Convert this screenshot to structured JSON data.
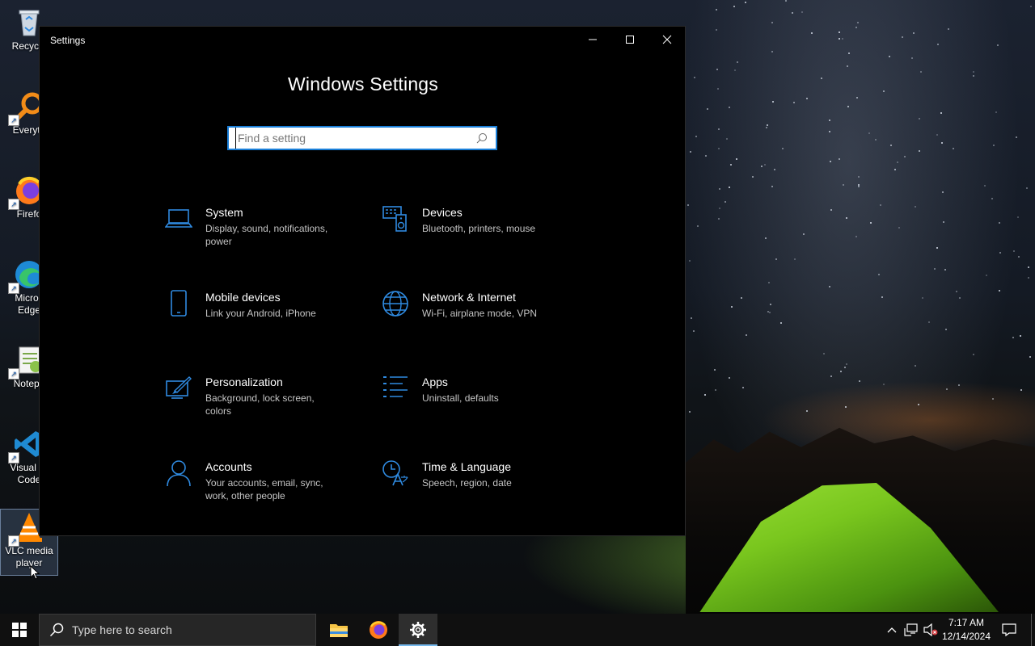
{
  "desktop": {
    "icons": [
      {
        "label": "Recycle"
      },
      {
        "label": "Everyth"
      },
      {
        "label": "Firefo"
      },
      {
        "label": "Micros\nEdge"
      },
      {
        "label": "Notepa"
      },
      {
        "label": "Visual St\nCode"
      },
      {
        "label": "VLC media\nplayer"
      }
    ]
  },
  "window": {
    "title": "Settings",
    "heading": "Windows Settings",
    "search_placeholder": "Find a setting",
    "categories": [
      {
        "name": "System",
        "desc": "Display, sound, notifications, power",
        "icon": "laptop-icon"
      },
      {
        "name": "Devices",
        "desc": "Bluetooth, printers, mouse",
        "icon": "keyboard-speaker-icon"
      },
      {
        "name": "Mobile devices",
        "desc": "Link your Android, iPhone",
        "icon": "phone-icon"
      },
      {
        "name": "Network & Internet",
        "desc": "Wi-Fi, airplane mode, VPN",
        "icon": "globe-icon"
      },
      {
        "name": "Personalization",
        "desc": "Background, lock screen, colors",
        "icon": "paint-icon"
      },
      {
        "name": "Apps",
        "desc": "Uninstall, defaults",
        "icon": "apps-list-icon"
      },
      {
        "name": "Accounts",
        "desc": "Your accounts, email, sync, work, other people",
        "icon": "person-icon"
      },
      {
        "name": "Time & Language",
        "desc": "Speech, region, date",
        "icon": "time-language-icon"
      }
    ]
  },
  "taskbar": {
    "search_label": "Type here to search",
    "time": "7:17 AM",
    "date": "12/14/2024"
  },
  "colors": {
    "accent": "#1a7fd9",
    "icon_blue": "#2f8ae0"
  }
}
